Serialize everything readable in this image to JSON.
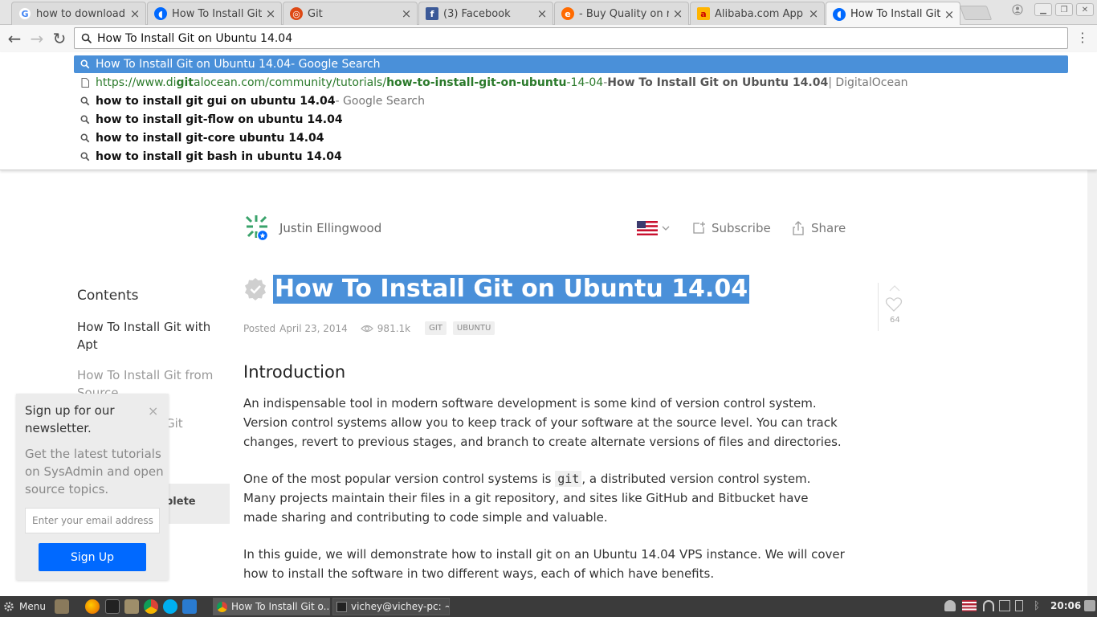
{
  "tabs": [
    {
      "title": "how to download",
      "favicon": "google-icon",
      "color": "#4285f4",
      "active": false
    },
    {
      "title": "How To Install Git",
      "favicon": "digitalocean-icon",
      "color": "#0069ff",
      "active": false
    },
    {
      "title": "Git",
      "favicon": "ubuntu-icon",
      "color": "#dd4814",
      "active": false
    },
    {
      "title": "(3) Facebook",
      "favicon": "facebook-icon",
      "color": "#3b5998",
      "active": false
    },
    {
      "title": "- Buy Quality on n",
      "favicon": "aliexpress-icon",
      "color": "#ff6a00",
      "active": false
    },
    {
      "title": "Alibaba.com App",
      "favicon": "alibaba-icon",
      "color": "#ff8c00",
      "active": false
    },
    {
      "title": "How To Install Git",
      "favicon": "digitalocean-icon",
      "color": "#0069ff",
      "active": true
    }
  ],
  "omnibox": {
    "value": "How To Install Git on Ubuntu 14.04"
  },
  "suggestions": {
    "s1": {
      "text": "How To Install Git on Ubuntu 14.04",
      "suffix": " - Google Search"
    },
    "s2": {
      "url_a": "https://www.di",
      "url_b": "git",
      "url_c": "alocean.com/community/tutorials/",
      "url_d": "how-to-install-git-on-ubuntu",
      "url_e": "-14-04",
      "sep": " - ",
      "title": "How To Install Git on Ubuntu 14.04",
      "tail": " | DigitalOcean"
    },
    "s3": {
      "text": "how to install git gui on ubuntu 14.04",
      "suffix": " - Google Search"
    },
    "s4": {
      "text": "how to install git-flow on ubuntu 14.04"
    },
    "s5": {
      "text": "how to install git-core ubuntu 14.04"
    },
    "s6": {
      "text": "how to install git bash in ubuntu 14.04"
    }
  },
  "article": {
    "author": "Justin Ellingwood",
    "subscribe": "Subscribe",
    "share": "Share",
    "title": "How To Install Git on Ubuntu 14.04",
    "posted_label": "Posted",
    "posted_date": "April 23, 2014",
    "views": "981.1k",
    "tags": [
      "GIT",
      "UBUNTU"
    ],
    "likes": "64",
    "intro_heading": "Introduction",
    "p1": "An indispensable tool in modern software development is some kind of version control system. Version control systems allow you to keep track of your software at the source level. You can track changes, revert to previous stages, and branch to create alternate versions of files and directories.",
    "p2_a": "One of the most popular version control systems is ",
    "p2_code": "git",
    "p2_b": ", a distributed version control system. Many projects maintain their files in a git repository, and sites like GitHub and Bitbucket have made sharing and contributing to code simple and valuable.",
    "p3": "In this guide, we will demonstrate how to install git on an Ubuntu 14.04 VPS instance. We will cover how to install the software in two different ways, each of which have benefits."
  },
  "toc": {
    "title": "Contents",
    "items": [
      "How To Install Git with Apt",
      "How To Install Git from Source",
      "Git"
    ],
    "box_text": "plete"
  },
  "newsletter": {
    "title": "Sign up for our newsletter.",
    "close": "×",
    "body": "Get the latest tutorials on SysAdmin and open source topics.",
    "placeholder": "Enter your email address",
    "button": "Sign Up"
  },
  "taskbar": {
    "menu": "Menu",
    "tasks": [
      {
        "title": "How To Install Git o..."
      },
      {
        "title": "vichey@vichey-pc: ~"
      }
    ],
    "clock": "20:06"
  },
  "colors": {
    "accent": "#0069ff",
    "selection": "#4a90d9"
  }
}
